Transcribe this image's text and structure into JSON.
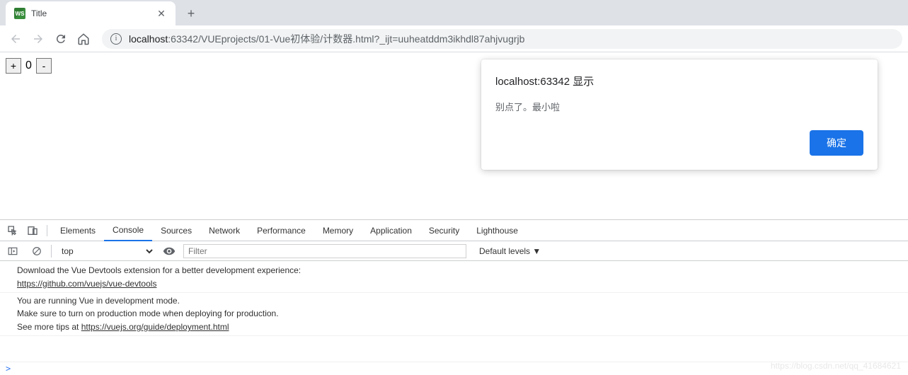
{
  "browser": {
    "tab_title": "Title",
    "url_host": "localhost",
    "url_port": ":63342",
    "url_path": "/VUEprojects/01-Vue初体验/计数器.html?_ijt=uuheatddm3ikhdl87ahjvugrjb"
  },
  "page": {
    "counter": {
      "plus_label": "+",
      "minus_label": "-",
      "value": "0"
    }
  },
  "alert": {
    "title": "localhost:63342 显示",
    "message": "别点了。最小啦",
    "confirm_label": "确定"
  },
  "devtools": {
    "tabs": [
      "Elements",
      "Console",
      "Sources",
      "Network",
      "Performance",
      "Memory",
      "Application",
      "Security",
      "Lighthouse"
    ],
    "active_tab_index": 1,
    "context_selector": "top",
    "filter_placeholder": "Filter",
    "levels_label": "Default levels ▼",
    "console": {
      "group1_line1": "Download the Vue Devtools extension for a better development experience:",
      "group1_link": "https://github.com/vuejs/vue-devtools",
      "group2_line1": "You are running Vue in development mode.",
      "group2_line2": "Make sure to turn on production mode when deploying for production.",
      "group2_line3_prefix": "See more tips at ",
      "group2_link": "https://vuejs.org/guide/deployment.html",
      "prompt": ">"
    }
  },
  "watermark": "https://blog.csdn.net/qq_41684621"
}
